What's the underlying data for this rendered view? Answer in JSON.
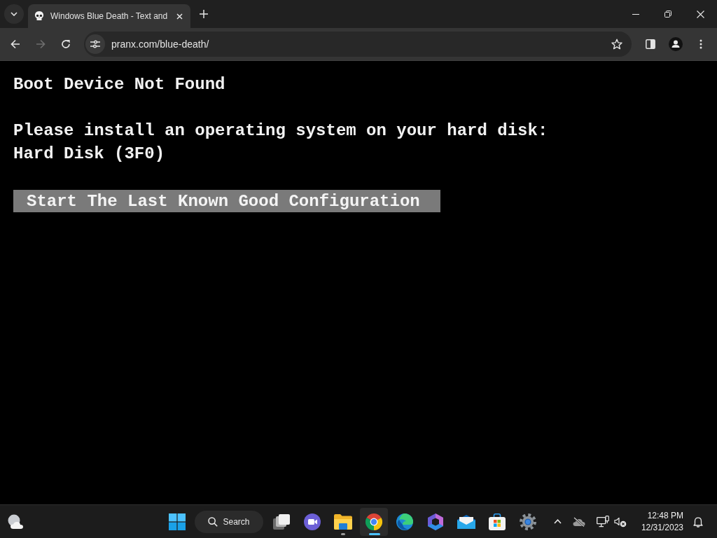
{
  "browser": {
    "tabs": [
      {
        "title": "Windows Blue Death - Text and",
        "selected": true
      }
    ],
    "toolbar": {
      "buttons": [
        {
          "kind": "back",
          "disabled": false
        },
        {
          "kind": "forward",
          "disabled": true
        },
        {
          "kind": "reload",
          "disabled": false
        }
      ],
      "address": "pranx.com/blue-death/"
    }
  },
  "page": {
    "heading": "Boot Device Not Found",
    "message": [
      "Please install an operating system on your hard disk:",
      "Hard Disk (3F0)"
    ],
    "button": "Start The Last Known Good Configuration"
  },
  "taskbar": {
    "search": "Search",
    "apps": [
      {
        "kind": "taskview",
        "running": false,
        "selected": false
      },
      {
        "kind": "chat",
        "running": false,
        "selected": false
      },
      {
        "kind": "folder",
        "running": true,
        "selected": false
      },
      {
        "kind": "chrome",
        "running": true,
        "selected": true
      },
      {
        "kind": "edge",
        "running": false,
        "selected": false
      },
      {
        "kind": "copilot",
        "running": false,
        "selected": false
      },
      {
        "kind": "mail",
        "running": false,
        "selected": false
      },
      {
        "kind": "store",
        "running": false,
        "selected": false
      },
      {
        "kind": "settings",
        "running": false,
        "selected": false
      }
    ],
    "volume_muted": true,
    "clock": {
      "time": "12:48 PM",
      "date": "12/31/2023"
    }
  }
}
